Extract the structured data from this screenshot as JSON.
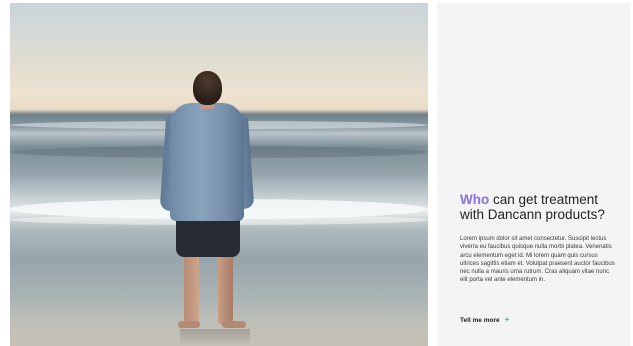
{
  "hero": {
    "image_subject": "man-standing-on-beach-photo"
  },
  "info_panel": {
    "headline_accent": "Who",
    "headline_rest": " can get treatment with Dancann products?",
    "body": "Lorem ipsum dolor sit amet consectetur. Suscipit lectus viverra eu faucibus quisque nulla morbi platea. Venenatis arcu elementum eget id. Mi lorem quam quis cursus ultrices sagittis etiam et. Volutpat praesent auctor faucibus nec nulla a mauris urna rutrum. Cras aliquam vitae nunc elit porta vel ante elementum in.",
    "cta_label": "Tell me more",
    "cta_icon": "+",
    "cta_icon_name": "plus-icon"
  },
  "colors": {
    "accent": "#8a70e0",
    "cta_icon": "#2fbf86",
    "panel_background": "#f4f4f4",
    "text": "#232326"
  }
}
